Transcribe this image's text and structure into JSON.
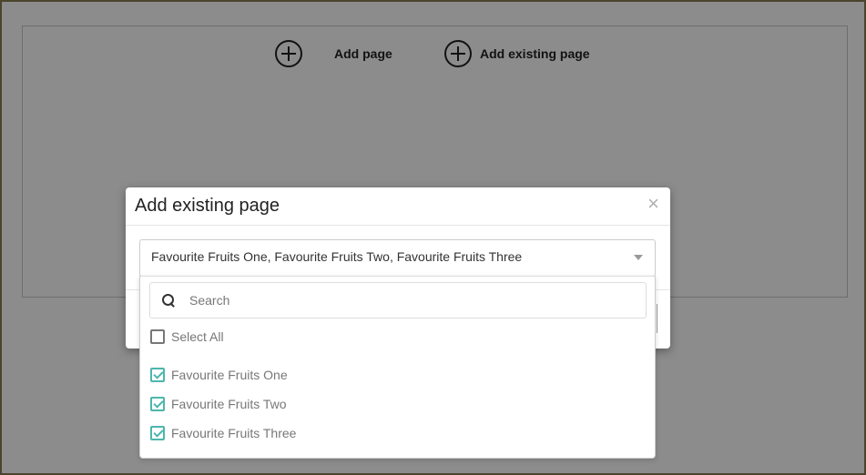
{
  "page": {
    "add_page_label": "Add page",
    "add_existing_page_label": "Add existing page"
  },
  "modal": {
    "title": "Add existing page",
    "close_glyph": "×",
    "select": {
      "value": "Favourite Fruits One, Favourite Fruits Two, Favourite Fruits Three"
    },
    "dropdown": {
      "search_placeholder": "Search",
      "select_all_label": "Select All",
      "select_all_checked": false,
      "options": [
        {
          "label": "Favourite Fruits One",
          "checked": true
        },
        {
          "label": "Favourite Fruits Two",
          "checked": true
        },
        {
          "label": "Favourite Fruits Three",
          "checked": true
        }
      ]
    }
  },
  "colors": {
    "accent": "#4db6ac",
    "overlay": "rgba(0,0,0,0.45)"
  }
}
